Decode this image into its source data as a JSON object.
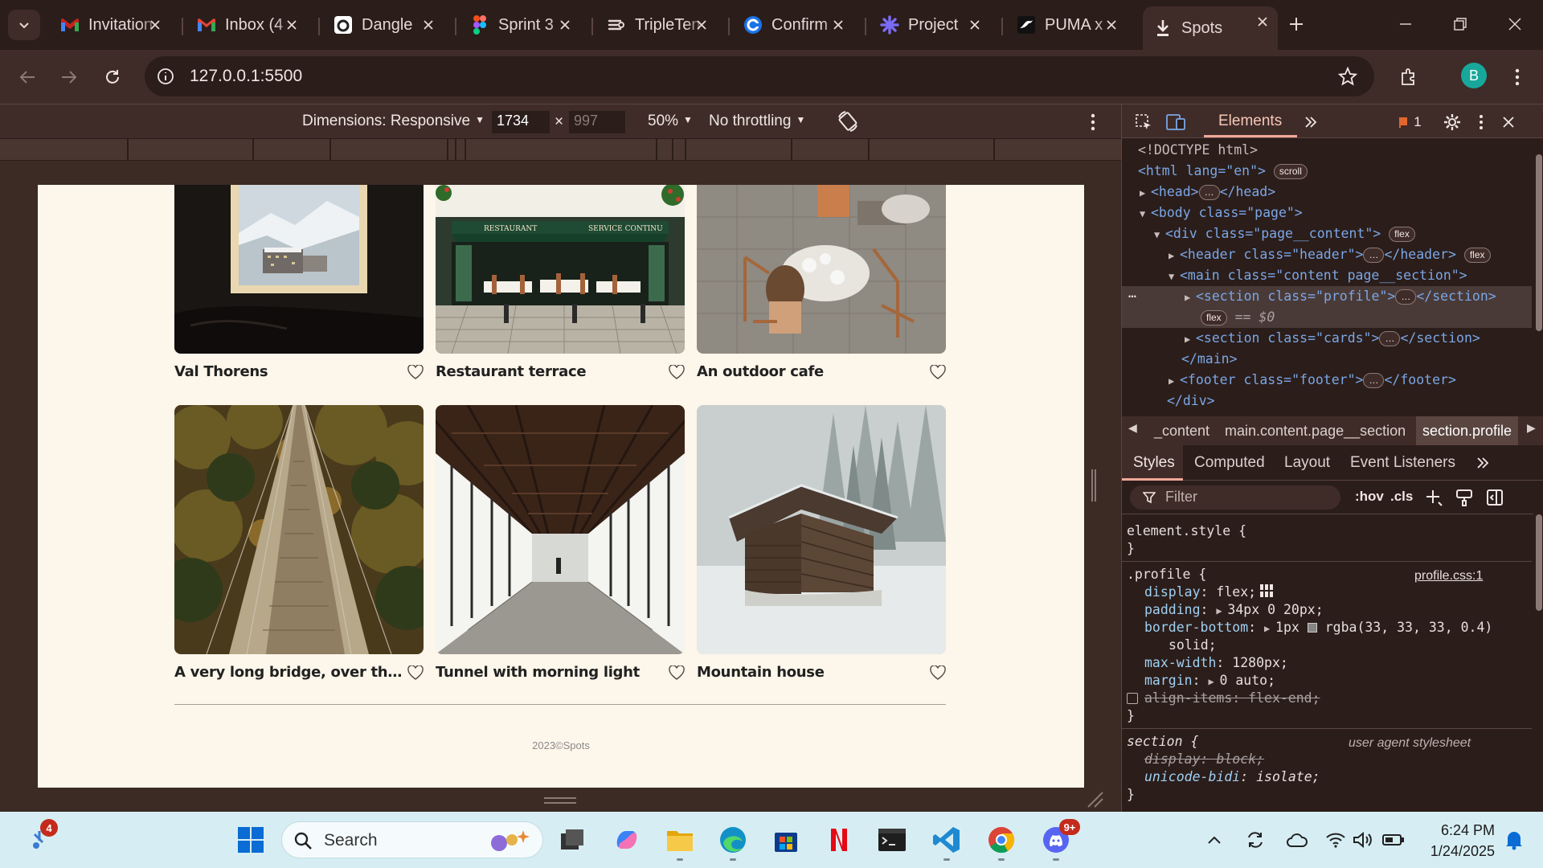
{
  "browser": {
    "tabs": [
      {
        "title": "Invitation",
        "icon": "gmail-icon"
      },
      {
        "title": "Inbox (4",
        "icon": "gmail-icon"
      },
      {
        "title": "Dangle",
        "icon": "dangle-icon"
      },
      {
        "title": "Sprint 3",
        "icon": "figma-icon"
      },
      {
        "title": "TripleTen",
        "icon": "tripleten-icon"
      },
      {
        "title": "Confirm",
        "icon": "google-c-icon"
      },
      {
        "title": "Project",
        "icon": "asterisk-icon"
      },
      {
        "title": "PUMA x",
        "icon": "puma-icon"
      },
      {
        "title": "Spots",
        "icon": "spots-icon",
        "active": true
      }
    ],
    "url": "127.0.0.1:5500",
    "profile_initial": "B"
  },
  "device_toolbar": {
    "dimensions_label": "Dimensions: Responsive",
    "width": "1734",
    "height": "997",
    "times": "×",
    "zoom": "50%",
    "throttling": "No throttling"
  },
  "page": {
    "cards": [
      {
        "caption": "Val Thorens"
      },
      {
        "caption": "Restaurant terrace"
      },
      {
        "caption": "An outdoor cafe"
      },
      {
        "caption": "A very long bridge, over the for..."
      },
      {
        "caption": "Tunnel with morning light"
      },
      {
        "caption": "Mountain house"
      }
    ],
    "restaurant_sign_left": "RESTAURANT",
    "restaurant_sign_right": "SERVICE CONTINU",
    "footer": "2023©Spots"
  },
  "devtools": {
    "tab_elements": "Elements",
    "issues_count": "1",
    "dom": {
      "doctype": "<!DOCTYPE html>",
      "html_open": "<html lang=\"en\">",
      "scroll_pill": "scroll",
      "head": "<head>",
      "head_close": "</head>",
      "body": "<body class=\"page\">",
      "div": "<div class=\"page__content\">",
      "flex_pill": "flex",
      "header": "<header class=\"header\">",
      "header_close": "</header>",
      "main": "<main class=\"content page__section\">",
      "section_profile": "<section class=\"profile\">",
      "section_close": "</section>",
      "eq0": "== $0",
      "section_cards": "<section class=\"cards\">",
      "main_close": "</main>",
      "footer": "<footer class=\"footer\">",
      "footer_close": "</footer>",
      "div_close": "</div>",
      "ellipsis": "…"
    },
    "breadcrumbs": [
      "_content",
      "main.content.page__section",
      "section.profile"
    ],
    "styles_tabs": [
      "Styles",
      "Computed",
      "Layout",
      "Event Listeners"
    ],
    "filter_placeholder": "Filter",
    "hov": ":hov",
    "cls": ".cls",
    "styles": {
      "element_style": "element.style {",
      "close_brace": "}",
      "profile_selector": ".profile {",
      "profile_source": "profile.css:1",
      "display": "display",
      "display_val": "flex;",
      "padding": "padding",
      "padding_val": "34px 0 20px;",
      "border_bottom": "border-bottom",
      "border_bottom_val": "1px",
      "border_bottom_color": "rgba(33, 33, 33, 0.4)",
      "border_bottom_style": "solid;",
      "max_width": "max-width",
      "max_width_val": "1280px;",
      "margin": "margin",
      "margin_val": "0 auto;",
      "align_items": "align-items: flex-end;",
      "section_selector": "section {",
      "ua_label": "user agent stylesheet",
      "ua_display": "display: block;",
      "ua_unicode_bidi": "unicode-bidi",
      "ua_unicode_bidi_val": "isolate;"
    }
  },
  "taskbar": {
    "search_label": "Search",
    "time": "6:24 PM",
    "date": "1/24/2025",
    "weather_badge": "4",
    "discord_badge": "9+"
  },
  "colors": {
    "chrome_dark": "#2b1d1a",
    "chrome_mid": "#3f2c28",
    "page_bg": "#fdf6ea",
    "text_dark": "#212121",
    "taskbar_bg": "#d6eef3"
  }
}
